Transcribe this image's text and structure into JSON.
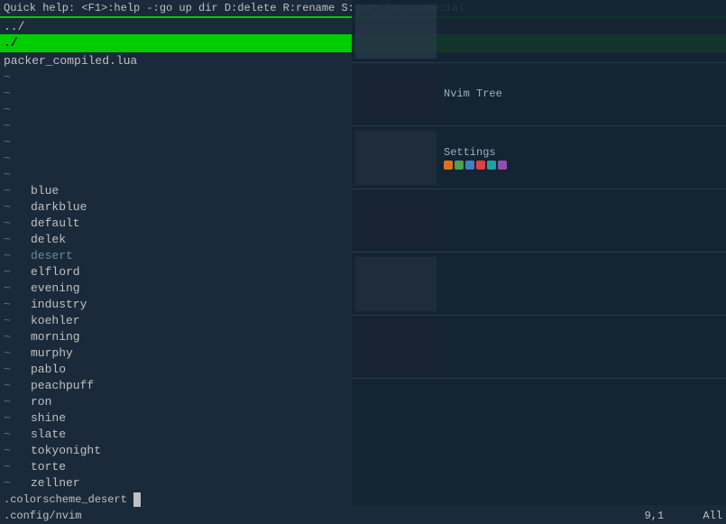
{
  "terminal": {
    "top_bar": "  Quick help: <F1>:help  -:go up dir  D:delete  R:rename  S:sort-by  x:special",
    "separator": "====================================================================================================",
    "parent_dir": "../",
    "current_dir": "./",
    "file": "packer_compiled.lua",
    "colorschemes": [
      {
        "tilde": "~",
        "name": ""
      },
      {
        "tilde": "~",
        "name": ""
      },
      {
        "tilde": "~",
        "name": ""
      },
      {
        "tilde": "~",
        "name": ""
      },
      {
        "tilde": "~",
        "name": ""
      },
      {
        "tilde": "~",
        "name": ""
      },
      {
        "tilde": "~",
        "name": ""
      },
      {
        "tilde": "~",
        "name": "blue"
      },
      {
        "tilde": "~",
        "name": "darkblue"
      },
      {
        "tilde": "~",
        "name": "default"
      },
      {
        "tilde": "~",
        "name": "delek"
      },
      {
        "tilde": "~",
        "name": "desert",
        "greyed": true
      },
      {
        "tilde": "~",
        "name": "elflord"
      },
      {
        "tilde": "~",
        "name": "evening"
      },
      {
        "tilde": "~",
        "name": "industry"
      },
      {
        "tilde": "~",
        "name": "koehler"
      },
      {
        "tilde": "~",
        "name": "morning"
      },
      {
        "tilde": "~",
        "name": "murphy"
      },
      {
        "tilde": "~",
        "name": "pablo"
      },
      {
        "tilde": "~",
        "name": "peachpuff"
      },
      {
        "tilde": "~",
        "name": "ron"
      },
      {
        "tilde": "~",
        "name": "shine"
      },
      {
        "tilde": "~",
        "name": "slate"
      },
      {
        "tilde": "~",
        "name": "tokyonight"
      },
      {
        "tilde": "~",
        "name": "torte"
      },
      {
        "tilde": "~",
        "name": "zellner"
      }
    ],
    "status_left": ".config/nvim",
    "status_right_pos": "9,1",
    "status_right_all": "All",
    "bottom_line": ".colorscheme_desert"
  },
  "right_panel": {
    "rows": [
      {
        "title": "",
        "sub": "",
        "thumbnail_color": "#2a3a4a",
        "has_dots": false,
        "dots": []
      },
      {
        "title": "Nvim Tree",
        "sub": "",
        "thumbnail_color": "#1a2530",
        "has_dots": false,
        "dots": []
      },
      {
        "title": "Settings",
        "sub": "",
        "thumbnail_color": "#233040",
        "has_dots": true,
        "dots": [
          "#e07020",
          "#50a050",
          "#4080c0",
          "#e04040",
          "#20a0a0",
          "#9050b0"
        ]
      },
      {
        "title": "",
        "sub": "",
        "thumbnail_color": "#1a2530",
        "has_dots": false,
        "dots": []
      },
      {
        "title": "",
        "sub": "",
        "thumbnail_color": "#233040",
        "has_dots": false,
        "dots": []
      },
      {
        "title": "",
        "sub": "",
        "thumbnail_color": "#1a2530",
        "has_dots": false,
        "dots": []
      }
    ]
  }
}
